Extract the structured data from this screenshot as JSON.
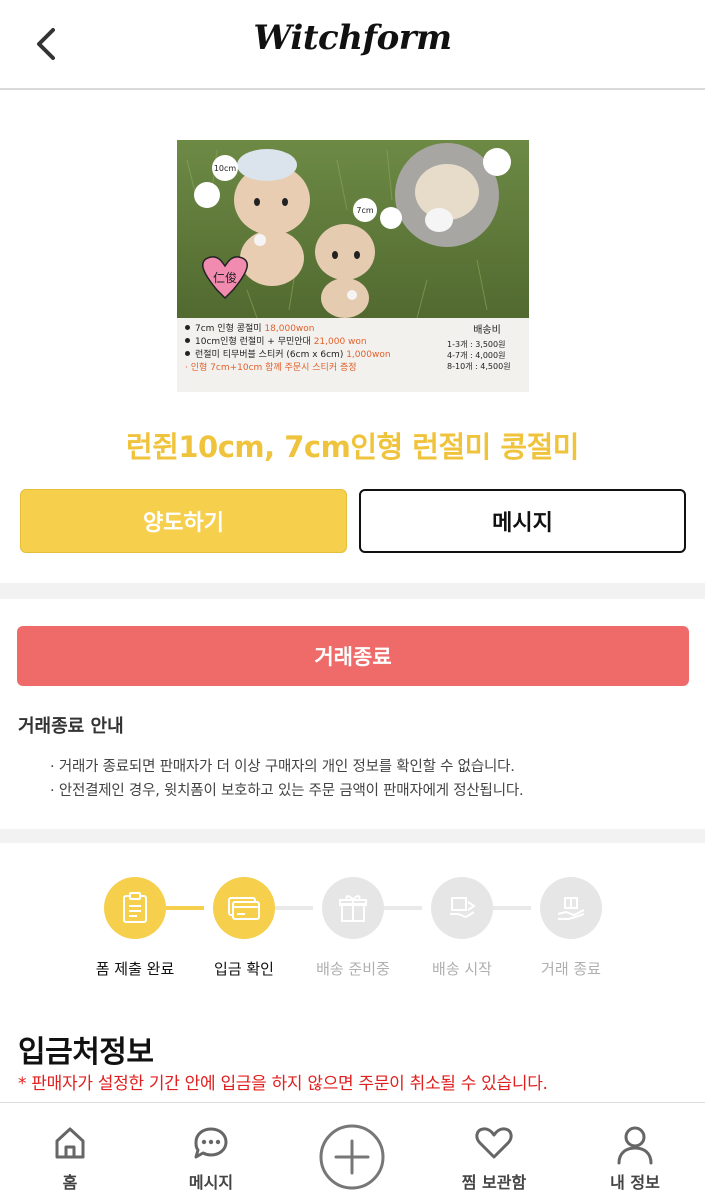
{
  "header": {
    "brand": "Witchform",
    "back_icon": "chevron-left-icon"
  },
  "product": {
    "image_caption": {
      "items": [
        {
          "text": "7cm 인형 콩절미 ",
          "price": "18,000won"
        },
        {
          "text": "10cm인형 런절미 + 무민안대 ",
          "price": "21,000 won"
        },
        {
          "text": "런절미 티무버블 스티커 (6cm x 6cm) ",
          "price": "1,000won"
        }
      ],
      "highlight": "· 인형 7cm+10cm 함께 주문시 스티커 증정",
      "shipping": {
        "title": "배송비",
        "rows": [
          "1-3개 : 3,500원",
          "4-7개 : 4,000원",
          "8-10개 : 4,500원"
        ]
      },
      "photo_labels": {
        "tag_10cm": "10cm",
        "tag_7cm": "7cm",
        "heart_text": "仁俊"
      }
    },
    "title": "런쥔10cm, 7cm인형 런절미 콩절미"
  },
  "actions": {
    "transfer_label": "양도하기",
    "message_label": "메시지",
    "end_trade_label": "거래종료"
  },
  "notice": {
    "title": "거래종료 안내",
    "lines": [
      "· 거래가 종료되면 판매자가 더 이상 구매자의 개인 정보를 확인할 수 없습니다.",
      "· 안전결제인 경우, 윗치폼이 보호하고 있는 주문 금액이 판매자에게 정산됩니다."
    ]
  },
  "steps": [
    {
      "label": "폼 제출 완료",
      "icon": "clipboard-icon",
      "done": true
    },
    {
      "label": "입금 확인",
      "icon": "credit-card-icon",
      "done": true
    },
    {
      "label": "배송 준비중",
      "icon": "gift-box-icon",
      "done": false
    },
    {
      "label": "배송 시작",
      "icon": "delivery-hand-icon",
      "done": false
    },
    {
      "label": "거래 종료",
      "icon": "gift-hand-icon",
      "done": false
    }
  ],
  "deposit_info": {
    "title": "입금처정보",
    "warning": "* 판매자가 설정한 기간 안에 입금을 하지 않으면 주문이 취소될 수 있습니다."
  },
  "bottom_nav": {
    "home": "홈",
    "messages": "메시지",
    "add_icon": "plus-circle-icon",
    "wishlist": "찜 보관함",
    "profile": "내 정보"
  },
  "colors": {
    "accent_yellow": "#f6cf4d",
    "title_yellow": "#f0c33c",
    "end_red": "#ee6b6a",
    "warning_red": "#e0201f"
  }
}
